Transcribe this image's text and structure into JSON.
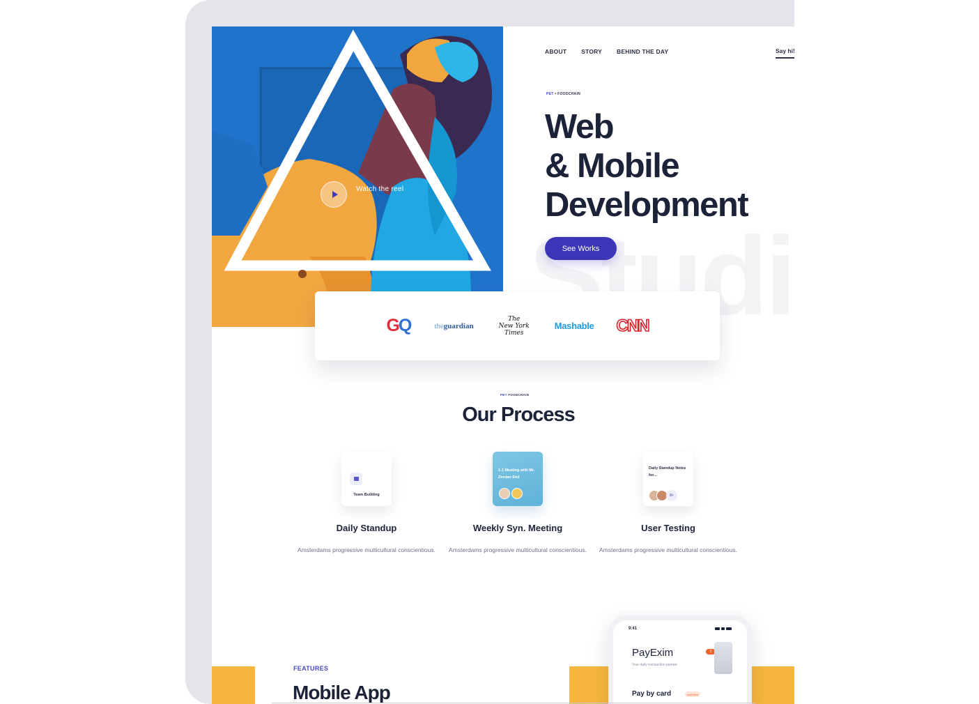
{
  "nav": {
    "items": [
      {
        "label": "ABOUT"
      },
      {
        "label": "STORY"
      },
      {
        "label": "BEHIND THE DAY"
      }
    ],
    "say_hi": "Say hi!"
  },
  "hero": {
    "crumb_a": "PET",
    "crumb_sep": "•",
    "crumb_b": "FOODCHAIN",
    "title_line1": "Web",
    "title_line2": "& Mobile",
    "title_line3": "Development",
    "cta_label": "See Works",
    "watermark": "Studio",
    "reel_label": "Watch the reel",
    "play_icon": "play-icon"
  },
  "press_logos": {
    "gq_a": "G",
    "gq_b": "Q",
    "guardian_a": "the",
    "guardian_b": "guardian",
    "nyt_1": "The",
    "nyt_2": "New York",
    "nyt_3": "Times",
    "mashable": "Mashable",
    "cnn": "CNN"
  },
  "process": {
    "crumb_a": "PET",
    "crumb_b": "FOODCHAIN",
    "title": "Our Process",
    "steps": [
      {
        "card_caption": "Team Building",
        "name": "Daily Standup",
        "description": "Amsterdams progressive multicultural conscientious."
      },
      {
        "card_caption": "1-1 Meeting with Mr. Zordan Smt",
        "name": "Weekly Syn. Meeting",
        "description": "Amsterdams progressive multicultural conscientious."
      },
      {
        "card_caption": "Daily Standup Notes for...",
        "card_extra": "8+",
        "name": "User Testing",
        "description": "Amsterdams progressive multicultural conscientious."
      }
    ]
  },
  "features": {
    "label": "FEATURES",
    "title": "Mobile App",
    "phone": {
      "time": "9:41",
      "app_name": "PayExim",
      "app_subtitle": "Your daily transaction partner",
      "badge": "2",
      "pay_label": "Pay by card",
      "add_new": "Add New"
    }
  },
  "colors": {
    "accent": "#3b36b8",
    "yellow": "#f7b73e",
    "dark_text": "#1c2238"
  }
}
